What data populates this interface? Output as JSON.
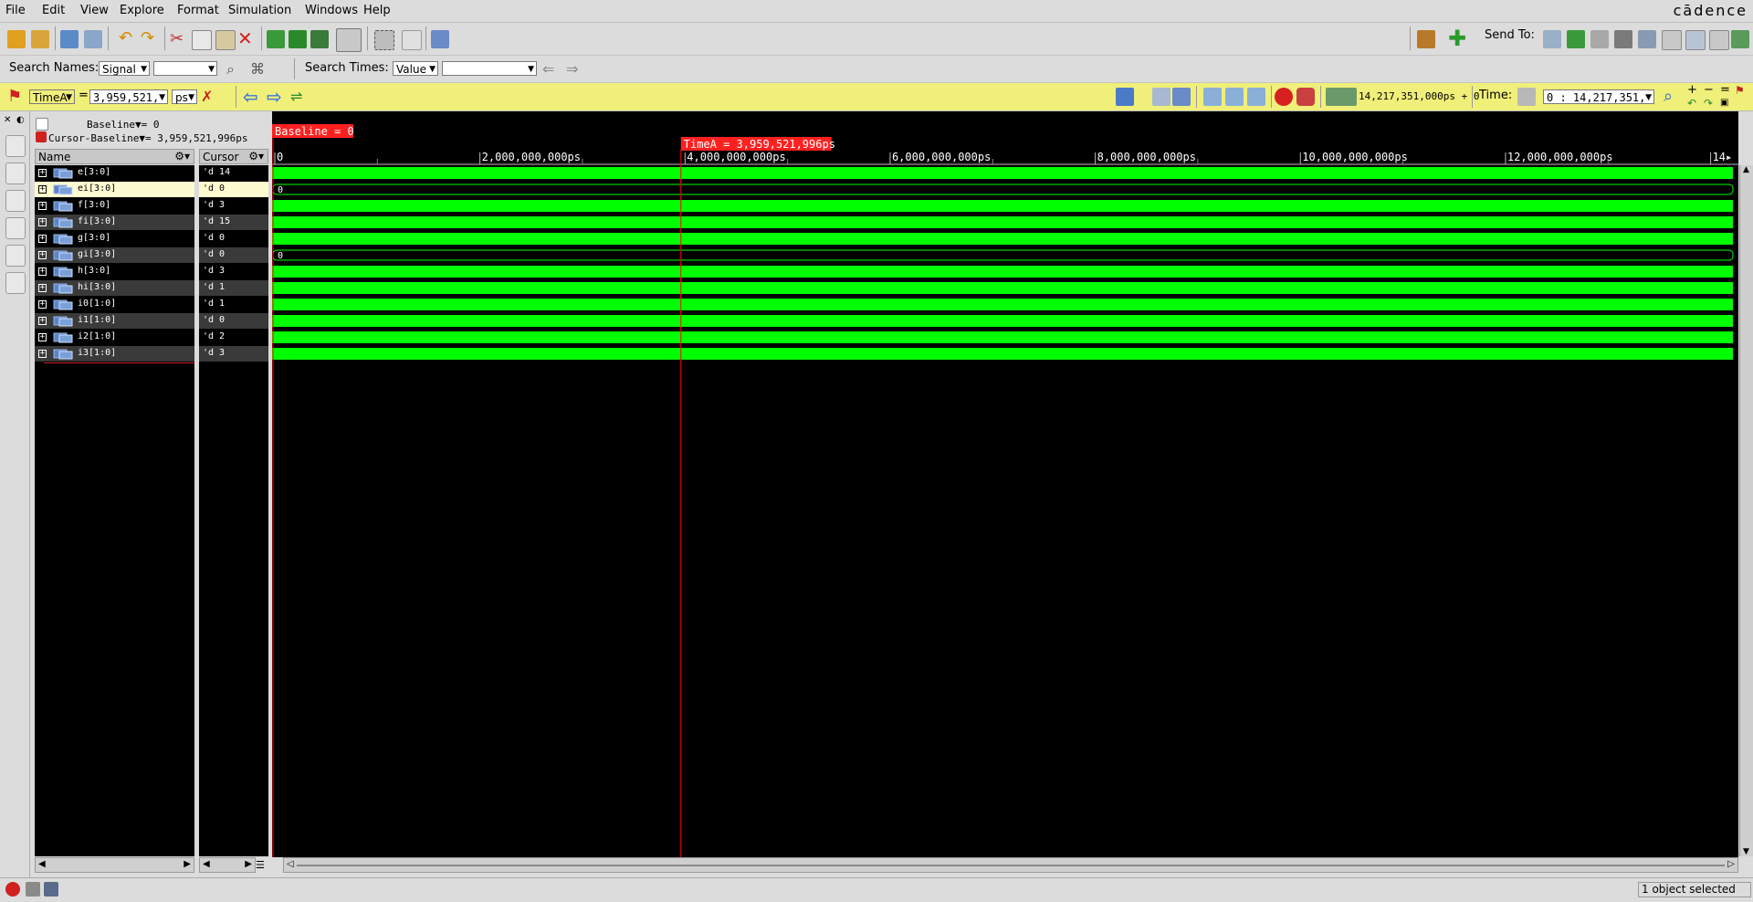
{
  "menu": {
    "file": "File",
    "edit": "Edit",
    "view": "View",
    "explore": "Explore",
    "format": "Format",
    "simulation": "Simulation",
    "windows": "Windows",
    "help": "Help",
    "logo": "cādence"
  },
  "toolbar": {
    "send_to_label": "Send To:"
  },
  "search": {
    "names_label": "Search Names:",
    "names_mode": "Signal",
    "names_value": "",
    "times_label": "Search Times:",
    "times_mode": "Value",
    "times_value": ""
  },
  "cursorbar": {
    "cursor_name": "TimeA",
    "equals": "=",
    "cursor_value": "3,959,521,",
    "unit": "ps",
    "sim_time": "14,217,351,000ps + 0",
    "time_label": "Time:",
    "time_range": "0 : 14,217,351,"
  },
  "info": {
    "baseline": "Baseline▼= 0",
    "cursor_baseline": "Cursor-Baseline▼= 3,959,521,996ps"
  },
  "headers": {
    "name": "Name",
    "cursor": "Cursor"
  },
  "signals": [
    {
      "name": "e[3:0]",
      "value": "'d 14",
      "wave": "bus",
      "wave_label": ""
    },
    {
      "name": "ei[3:0]",
      "value": "'d 0",
      "wave": "zero",
      "wave_label": "0"
    },
    {
      "name": "f[3:0]",
      "value": "'d 3",
      "wave": "bus",
      "wave_label": ""
    },
    {
      "name": "fi[3:0]",
      "value": "'d 15",
      "wave": "bus",
      "wave_label": ""
    },
    {
      "name": "g[3:0]",
      "value": "'d 0",
      "wave": "bus",
      "wave_label": ""
    },
    {
      "name": "gi[3:0]",
      "value": "'d 0",
      "wave": "zero",
      "wave_label": "0"
    },
    {
      "name": "h[3:0]",
      "value": "'d 3",
      "wave": "bus",
      "wave_label": ""
    },
    {
      "name": "hi[3:0]",
      "value": "'d 1",
      "wave": "bus",
      "wave_label": ""
    },
    {
      "name": "i0[1:0]",
      "value": "'d 1",
      "wave": "bus",
      "wave_label": ""
    },
    {
      "name": "i1[1:0]",
      "value": "'d 0",
      "wave": "bus",
      "wave_label": ""
    },
    {
      "name": "i2[1:0]",
      "value": "'d 2",
      "wave": "bus",
      "wave_label": ""
    },
    {
      "name": "i3[1:0]",
      "value": "'d 3",
      "wave": "bus",
      "wave_label": ""
    }
  ],
  "selected_signal_index": 1,
  "waveform": {
    "baseline_label": "Baseline = 0",
    "cursor_label": "TimeA = 3,959,521,996ps",
    "time_max_ps": 14217351000,
    "cursor_time_ps": 3959521996,
    "ticks": [
      {
        "t": 0,
        "label": "0"
      },
      {
        "t": 2000000000,
        "label": "2,000,000,000ps"
      },
      {
        "t": 4000000000,
        "label": "4,000,000,000ps"
      },
      {
        "t": 6000000000,
        "label": "6,000,000,000ps"
      },
      {
        "t": 8000000000,
        "label": "8,000,000,000ps"
      },
      {
        "t": 10000000000,
        "label": "10,000,000,000ps"
      },
      {
        "t": 12000000000,
        "label": "12,000,000,000ps"
      },
      {
        "t": 14000000000,
        "label": "14▸"
      }
    ],
    "colors": {
      "bus": "#00ff00",
      "cursor": "#ff0000",
      "zero_outline": "#00ff00",
      "selected_row": "#fffbd0"
    }
  },
  "status": {
    "text": "1 object selected"
  }
}
